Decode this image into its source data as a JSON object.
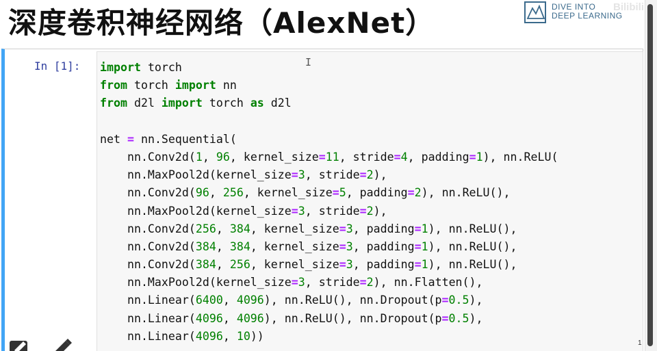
{
  "slide": {
    "title": "深度卷积神经网络（AlexNet）"
  },
  "logo": {
    "icon": "book-logo-icon",
    "line1": "DIVE INTO",
    "line2": "DEEP LEARNING"
  },
  "watermark": "Bilibili",
  "notebook": {
    "prompt": "In [1]:",
    "colors": {
      "cell_border_accent": "#42a5f5",
      "keyword": "#008000",
      "number": "#008000",
      "operator": "#aa22ff",
      "prompt": "#303f9f"
    },
    "code_lines": [
      [
        {
          "t": "import",
          "c": "kw"
        },
        {
          "t": " torch"
        }
      ],
      [
        {
          "t": "from",
          "c": "kw"
        },
        {
          "t": " torch "
        },
        {
          "t": "import",
          "c": "kw"
        },
        {
          "t": " nn"
        }
      ],
      [
        {
          "t": "from",
          "c": "kw"
        },
        {
          "t": " d2l "
        },
        {
          "t": "import",
          "c": "kw"
        },
        {
          "t": " torch "
        },
        {
          "t": "as",
          "c": "kw"
        },
        {
          "t": " d2l"
        }
      ],
      [],
      [
        {
          "t": "net "
        },
        {
          "t": "=",
          "c": "op"
        },
        {
          "t": " nn.Sequential("
        }
      ],
      [
        {
          "t": "    nn.Conv2d("
        },
        {
          "t": "1",
          "c": "num"
        },
        {
          "t": ", "
        },
        {
          "t": "96",
          "c": "num"
        },
        {
          "t": ", kernel_size"
        },
        {
          "t": "=",
          "c": "op"
        },
        {
          "t": "11",
          "c": "num"
        },
        {
          "t": ", stride"
        },
        {
          "t": "=",
          "c": "op"
        },
        {
          "t": "4",
          "c": "num"
        },
        {
          "t": ", padding"
        },
        {
          "t": "=",
          "c": "op"
        },
        {
          "t": "1",
          "c": "num"
        },
        {
          "t": "), nn.ReLU("
        }
      ],
      [
        {
          "t": "    nn.MaxPool2d(kernel_size"
        },
        {
          "t": "=",
          "c": "op"
        },
        {
          "t": "3",
          "c": "num"
        },
        {
          "t": ", stride"
        },
        {
          "t": "=",
          "c": "op"
        },
        {
          "t": "2",
          "c": "num"
        },
        {
          "t": "),"
        }
      ],
      [
        {
          "t": "    nn.Conv2d("
        },
        {
          "t": "96",
          "c": "num"
        },
        {
          "t": ", "
        },
        {
          "t": "256",
          "c": "num"
        },
        {
          "t": ", kernel_size"
        },
        {
          "t": "=",
          "c": "op"
        },
        {
          "t": "5",
          "c": "num"
        },
        {
          "t": ", padding"
        },
        {
          "t": "=",
          "c": "op"
        },
        {
          "t": "2",
          "c": "num"
        },
        {
          "t": "), nn.ReLU(),"
        }
      ],
      [
        {
          "t": "    nn.MaxPool2d(kernel_size"
        },
        {
          "t": "=",
          "c": "op"
        },
        {
          "t": "3",
          "c": "num"
        },
        {
          "t": ", stride"
        },
        {
          "t": "=",
          "c": "op"
        },
        {
          "t": "2",
          "c": "num"
        },
        {
          "t": "),"
        }
      ],
      [
        {
          "t": "    nn.Conv2d("
        },
        {
          "t": "256",
          "c": "num"
        },
        {
          "t": ", "
        },
        {
          "t": "384",
          "c": "num"
        },
        {
          "t": ", kernel_size"
        },
        {
          "t": "=",
          "c": "op"
        },
        {
          "t": "3",
          "c": "num"
        },
        {
          "t": ", padding"
        },
        {
          "t": "=",
          "c": "op"
        },
        {
          "t": "1",
          "c": "num"
        },
        {
          "t": "), nn.ReLU(),"
        }
      ],
      [
        {
          "t": "    nn.Conv2d("
        },
        {
          "t": "384",
          "c": "num"
        },
        {
          "t": ", "
        },
        {
          "t": "384",
          "c": "num"
        },
        {
          "t": ", kernel_size"
        },
        {
          "t": "=",
          "c": "op"
        },
        {
          "t": "3",
          "c": "num"
        },
        {
          "t": ", padding"
        },
        {
          "t": "=",
          "c": "op"
        },
        {
          "t": "1",
          "c": "num"
        },
        {
          "t": "), nn.ReLU(),"
        }
      ],
      [
        {
          "t": "    nn.Conv2d("
        },
        {
          "t": "384",
          "c": "num"
        },
        {
          "t": ", "
        },
        {
          "t": "256",
          "c": "num"
        },
        {
          "t": ", kernel_size"
        },
        {
          "t": "=",
          "c": "op"
        },
        {
          "t": "3",
          "c": "num"
        },
        {
          "t": ", padding"
        },
        {
          "t": "=",
          "c": "op"
        },
        {
          "t": "1",
          "c": "num"
        },
        {
          "t": "), nn.ReLU(),"
        }
      ],
      [
        {
          "t": "    nn.MaxPool2d(kernel_size"
        },
        {
          "t": "=",
          "c": "op"
        },
        {
          "t": "3",
          "c": "num"
        },
        {
          "t": ", stride"
        },
        {
          "t": "=",
          "c": "op"
        },
        {
          "t": "2",
          "c": "num"
        },
        {
          "t": "), nn.Flatten(),"
        }
      ],
      [
        {
          "t": "    nn.Linear("
        },
        {
          "t": "6400",
          "c": "num"
        },
        {
          "t": ", "
        },
        {
          "t": "4096",
          "c": "num"
        },
        {
          "t": "), nn.ReLU(), nn.Dropout(p"
        },
        {
          "t": "=",
          "c": "op"
        },
        {
          "t": "0.5",
          "c": "num"
        },
        {
          "t": "),"
        }
      ],
      [
        {
          "t": "    nn.Linear("
        },
        {
          "t": "4096",
          "c": "num"
        },
        {
          "t": ", "
        },
        {
          "t": "4096",
          "c": "num"
        },
        {
          "t": "), nn.ReLU(), nn.Dropout(p"
        },
        {
          "t": "=",
          "c": "op"
        },
        {
          "t": "0.5",
          "c": "num"
        },
        {
          "t": "),"
        }
      ],
      [
        {
          "t": "    nn.Linear("
        },
        {
          "t": "4096",
          "c": "num"
        },
        {
          "t": ", "
        },
        {
          "t": "10",
          "c": "num"
        },
        {
          "t": "))"
        }
      ]
    ]
  },
  "icons": {
    "text_cursor": "I-beam-cursor-icon",
    "edit_tools": [
      "pencil-icon",
      "pencil-icon"
    ]
  },
  "page_indicator": "1"
}
